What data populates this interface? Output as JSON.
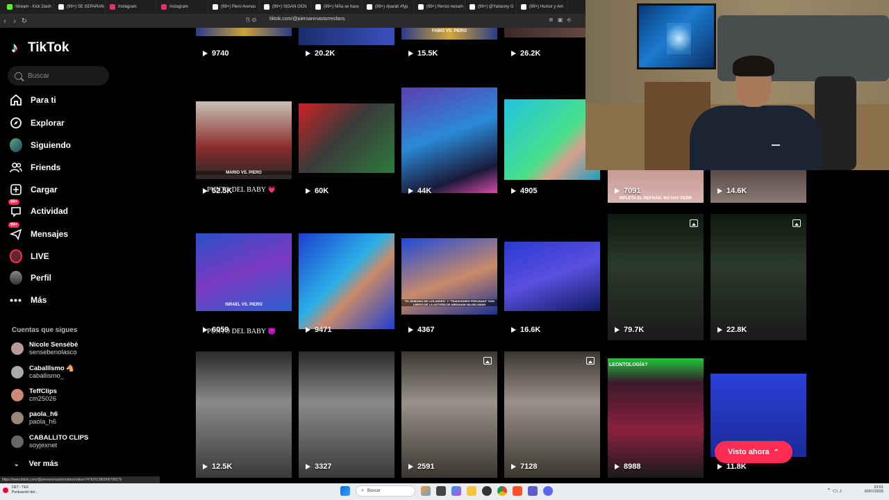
{
  "browser": {
    "tabs": [
      {
        "label": "Stream - Kick Dash",
        "color": "#53fc18"
      },
      {
        "label": "(99+) SE SEPARAN",
        "color": "#ffffff"
      },
      {
        "label": "Instagram",
        "color": "#e1306c"
      },
      {
        "label": "Instagram",
        "color": "#e1306c"
      },
      {
        "label": "(99+) Piero Arenas",
        "color": "#ffffff"
      },
      {
        "label": "(99+) SIGAN GEN",
        "color": "#ffffff"
      },
      {
        "label": "(99+) Niña se hace",
        "color": "#ffffff"
      },
      {
        "label": "(99+) #parati #fyp",
        "color": "#ffffff"
      },
      {
        "label": "(99+) Renzo reclam",
        "color": "#ffffff"
      },
      {
        "label": "(99+) @Yarianny G",
        "color": "#ffffff"
      },
      {
        "label": "(99+) Humor y Am",
        "color": "#ffffff"
      }
    ],
    "url": "tiktok.com/@pieroarenastorresfans",
    "status_url": "https://www.tiktok.com/@pieroarenastorresfans/video/7476291380906708279"
  },
  "sidebar": {
    "logo": "TikTok",
    "search_placeholder": "Buscar",
    "nav": [
      {
        "label": "Para ti",
        "icon": "home-icon"
      },
      {
        "label": "Explorar",
        "icon": "compass-icon"
      },
      {
        "label": "Siguiendo",
        "icon": "following-avatar-icon"
      },
      {
        "label": "Friends",
        "icon": "friends-icon"
      },
      {
        "label": "Cargar",
        "icon": "upload-icon"
      },
      {
        "label": "Actividad",
        "icon": "activity-icon",
        "badge": "99+"
      },
      {
        "label": "Mensajes",
        "icon": "messages-icon",
        "badge": "99+"
      },
      {
        "label": "LIVE",
        "icon": "live-icon"
      },
      {
        "label": "Perfil",
        "icon": "profile-icon"
      },
      {
        "label": "Más",
        "icon": "more-icon"
      }
    ],
    "following_title": "Cuentas que sigues",
    "following": [
      {
        "name": "Nicole Sensébé",
        "handle": "sensebenolasco"
      },
      {
        "name": "Caballlsmo 🐴",
        "handle": "caballismo_"
      },
      {
        "name": "TeffClips",
        "handle": "cm25026"
      },
      {
        "name": "paola_h6",
        "handle": "paola_h6"
      },
      {
        "name": "CABALLITO CLIPS",
        "handle": "soyjexnet"
      }
    ],
    "see_more": "Ver más"
  },
  "grid": {
    "row0": [
      {
        "views": "9740",
        "caption": ""
      },
      {
        "views": "20.2K",
        "caption": ""
      },
      {
        "views": "15.5K",
        "caption": "FABIO VS. PIERO"
      },
      {
        "views": "26.2K",
        "caption": ""
      }
    ],
    "row1": [
      {
        "views": "52.5K",
        "overlay": "PUNTO DEL BABY 💗",
        "caption": "MARIO VS. PIERO"
      },
      {
        "views": "60K",
        "overlay": "",
        "caption": ""
      },
      {
        "views": "44K",
        "overlay": "",
        "caption": ""
      },
      {
        "views": "4905",
        "overlay": "",
        "caption": ""
      },
      {
        "views": "7091",
        "overlay": "",
        "caption": "MPLETA EL REFRÁN: NO HAY PERR"
      },
      {
        "views": "14.6K",
        "overlay": "",
        "caption": ""
      }
    ],
    "row2": [
      {
        "views": "6059",
        "overlay": "PUNTO DEL BABY 😈",
        "caption": "ISRAEL VS. PIERO"
      },
      {
        "views": "9471",
        "overlay": "",
        "caption": ""
      },
      {
        "views": "4367",
        "overlay": "",
        "caption": "\"EL DEMONIO DE LOS ANDES\" Y \"TRADICIONES PERUANAS\" SON LIBROS DE LA AUTORÍA DE ABRAHAM VALDELOMAR"
      },
      {
        "views": "16.6K",
        "overlay": "",
        "caption": ""
      },
      {
        "views": "79.7K",
        "overlay": "",
        "caption": ""
      },
      {
        "views": "22.8K",
        "overlay": "",
        "caption": ""
      }
    ],
    "row3": [
      {
        "views": "12.5K",
        "caption": ""
      },
      {
        "views": "3327",
        "caption": ""
      },
      {
        "views": "2591",
        "caption": ""
      },
      {
        "views": "7128",
        "caption": ""
      },
      {
        "views": "8988",
        "caption": "LEONTOLOGÍA?"
      },
      {
        "views": "11.8K",
        "caption": ""
      }
    ]
  },
  "visto_ahora": "Visto ahora",
  "taskbar": {
    "left_title": "DET - TEX",
    "left_sub": "Puntuación del...",
    "search": "Buscar",
    "time": "23:51",
    "date": "20/07/2025"
  }
}
